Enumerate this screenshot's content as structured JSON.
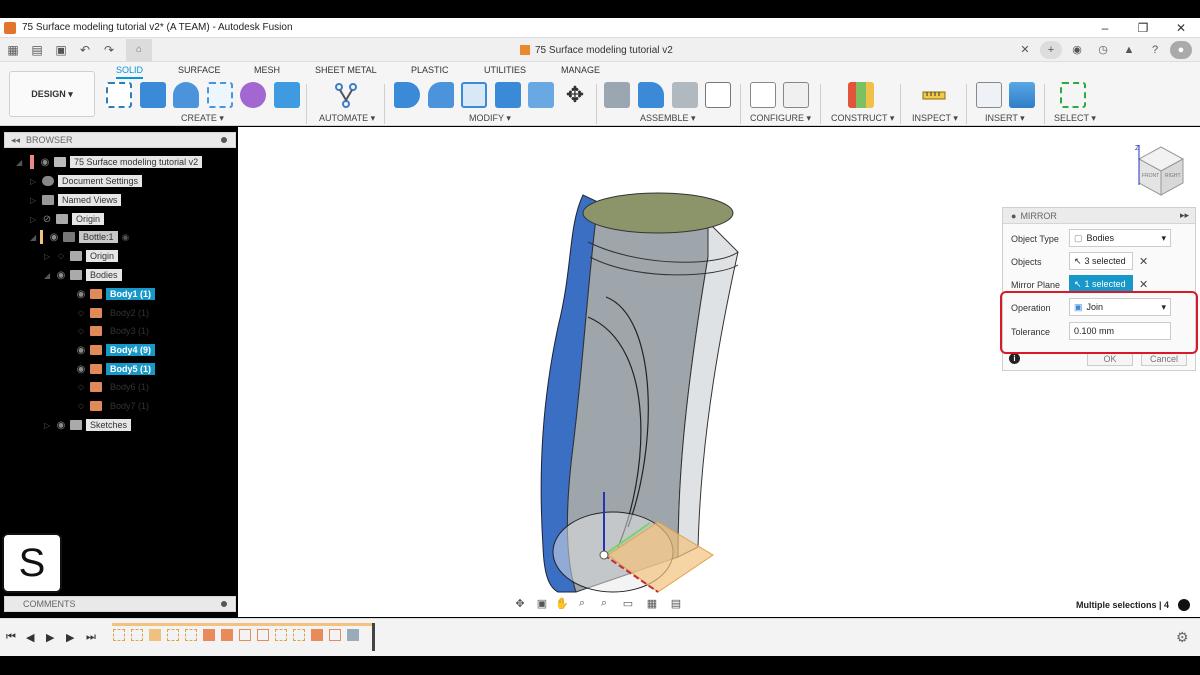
{
  "window": {
    "title": "75 Surface modeling tutorial v2* (A TEAM) - Autodesk Fusion",
    "minimize": "–",
    "maximize": "❐",
    "close": "✕"
  },
  "document_tab": {
    "label": "75 Surface modeling tutorial v2",
    "close": "✕"
  },
  "ribbon": {
    "workspace": "DESIGN ▾",
    "tabs": [
      "SOLID",
      "SURFACE",
      "MESH",
      "SHEET METAL",
      "PLASTIC",
      "UTILITIES",
      "MANAGE"
    ],
    "active_tab": "SOLID",
    "groups": [
      "CREATE ▾",
      "AUTOMATE ▾",
      "MODIFY ▾",
      "ASSEMBLE ▾",
      "CONFIGURE ▾",
      "CONSTRUCT ▾",
      "INSPECT ▾",
      "INSERT ▾",
      "SELECT ▾"
    ]
  },
  "browser": {
    "header": "BROWSER",
    "root": "75 Surface modeling tutorial v2",
    "nodes": [
      {
        "label": "Document Settings"
      },
      {
        "label": "Named Views"
      },
      {
        "label": "Origin"
      },
      {
        "label": "Bottle:1"
      },
      {
        "label": "Origin"
      },
      {
        "label": "Bodies"
      },
      {
        "label": "Body1 (1)"
      },
      {
        "label": "Body2 (1)"
      },
      {
        "label": "Body3 (1)"
      },
      {
        "label": "Body4 (9)"
      },
      {
        "label": "Body5 (1)"
      },
      {
        "label": "Body6 (1)"
      },
      {
        "label": "Body7 (1)"
      },
      {
        "label": "Sketches"
      }
    ]
  },
  "comments": {
    "label": "COMMENTS"
  },
  "mirror": {
    "title": "MIRROR",
    "object_type_label": "Object Type",
    "object_type_value": "Bodies",
    "objects_label": "Objects",
    "objects_value": "3 selected",
    "mirror_plane_label": "Mirror Plane",
    "mirror_plane_value": "1 selected",
    "operation_label": "Operation",
    "operation_value": "Join",
    "tolerance_label": "Tolerance",
    "tolerance_value": "0.100 mm",
    "ok": "OK",
    "cancel": "Cancel",
    "info": "i"
  },
  "status": {
    "selection": "Multiple selections | 4"
  },
  "viewcube": {
    "front": "FRONT",
    "right": "RIGHT",
    "axis_z": "Z"
  },
  "logo": {
    "letter": "S"
  },
  "colors": {
    "accent": "#0696d7",
    "selection": "#1898c9",
    "highlight": "#d9192b",
    "body_blue": "#3a6fc4"
  }
}
